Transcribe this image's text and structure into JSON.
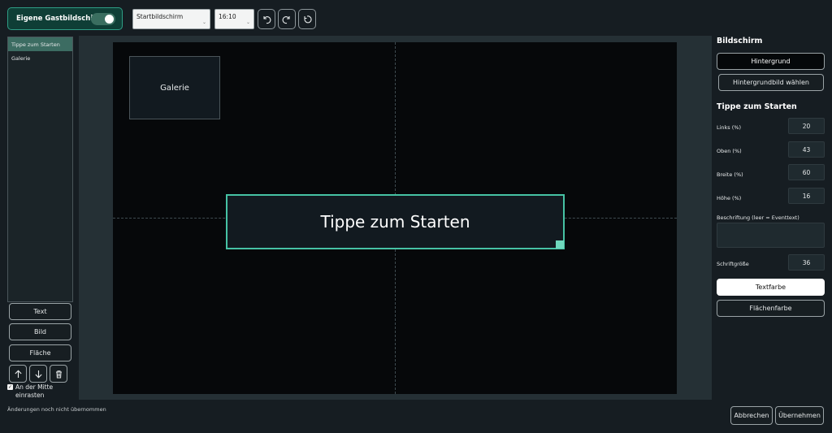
{
  "header": {
    "toggle_label": "Eigene Gastbildschirme",
    "toggle_on": true,
    "screen_select": "Startbildschirm",
    "ratio_select": "16:10"
  },
  "elements_list": {
    "items": [
      {
        "label": "Tippe zum Starten",
        "selected": true
      },
      {
        "label": "Galerie",
        "selected": false
      }
    ]
  },
  "add_buttons": {
    "text": "Text",
    "image": "Bild",
    "area": "Fläche"
  },
  "snap": {
    "label": "An der Mitte einrasten",
    "checked": true
  },
  "status": "Änderungen noch nicht übernommen",
  "canvas": {
    "galerie_label": "Galerie",
    "start_label": "Tippe zum Starten"
  },
  "right_panel": {
    "screen_heading": "Bildschirm",
    "background_button": "Hintergrund",
    "background_image_button": "Hintergrundbild wählen",
    "element_heading": "Tippe zum Starten",
    "left_label": "Links (%)",
    "left_value": "20",
    "top_label": "Oben (%)",
    "top_value": "43",
    "width_label": "Breite (%)",
    "width_value": "60",
    "height_label": "Höhe (%)",
    "height_value": "16",
    "caption_label": "Beschriftung (leer = Eventtext)",
    "caption_value": "",
    "fontsize_label": "Schriftgröße",
    "fontsize_value": "36",
    "textcolor_button": "Textfarbe",
    "areacolor_button": "Flächenfarbe"
  },
  "footer": {
    "cancel": "Abbrechen",
    "apply": "Übernehmen"
  },
  "colors": {
    "accent": "#46c2a4",
    "toggle_bg": "#0f3e36",
    "selected_row": "#3c6c62",
    "canvas": "#06080a"
  }
}
